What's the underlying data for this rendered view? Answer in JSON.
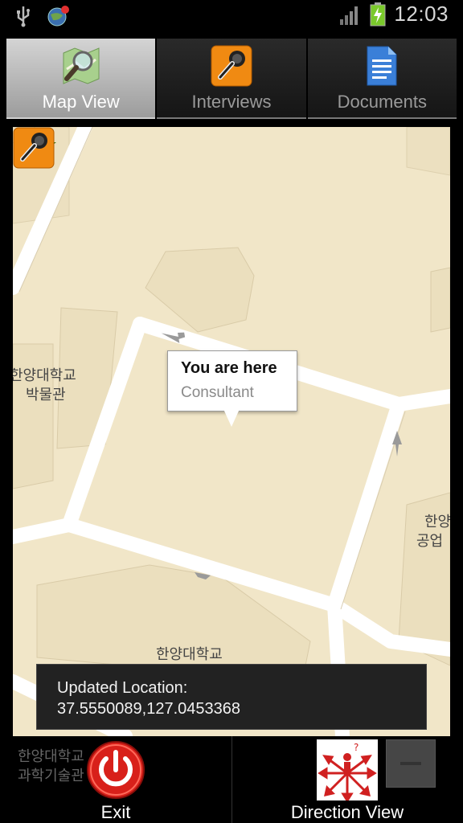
{
  "status_bar": {
    "time": "12:03",
    "icons": [
      "usb-icon",
      "globe-notification-icon",
      "signal-icon",
      "battery-charging-icon"
    ]
  },
  "tabs": [
    {
      "label": "Map View",
      "icon": "map-search-icon",
      "selected": true
    },
    {
      "label": "Interviews",
      "icon": "microphone-icon",
      "selected": false
    },
    {
      "label": "Documents",
      "icon": "document-icon",
      "selected": false
    }
  ],
  "map": {
    "labels": {
      "museum_line1": "한양대학교",
      "museum_line2": "박물관",
      "right_line1": "한양",
      "right_line2": "공업",
      "bottom": "한양대학교"
    },
    "callout": {
      "title": "You are here",
      "subtitle": "Consultant"
    },
    "markers": [
      "star-location-icon",
      "microphone-icon"
    ],
    "colors": {
      "land": "#f1e6c8",
      "road": "#ffffff",
      "building": "#e9dcba"
    }
  },
  "toast": {
    "line1": "Updated Location:",
    "line2": "37.5550089,127.0453368"
  },
  "bottom_bar": {
    "overlay_line1": "한양대학교",
    "overlay_line2": "과학기술관",
    "exit_label": "Exit",
    "exit_icon": "power-icon",
    "direction_label": "Direction View",
    "direction_icon": "direction-arrows-icon"
  }
}
